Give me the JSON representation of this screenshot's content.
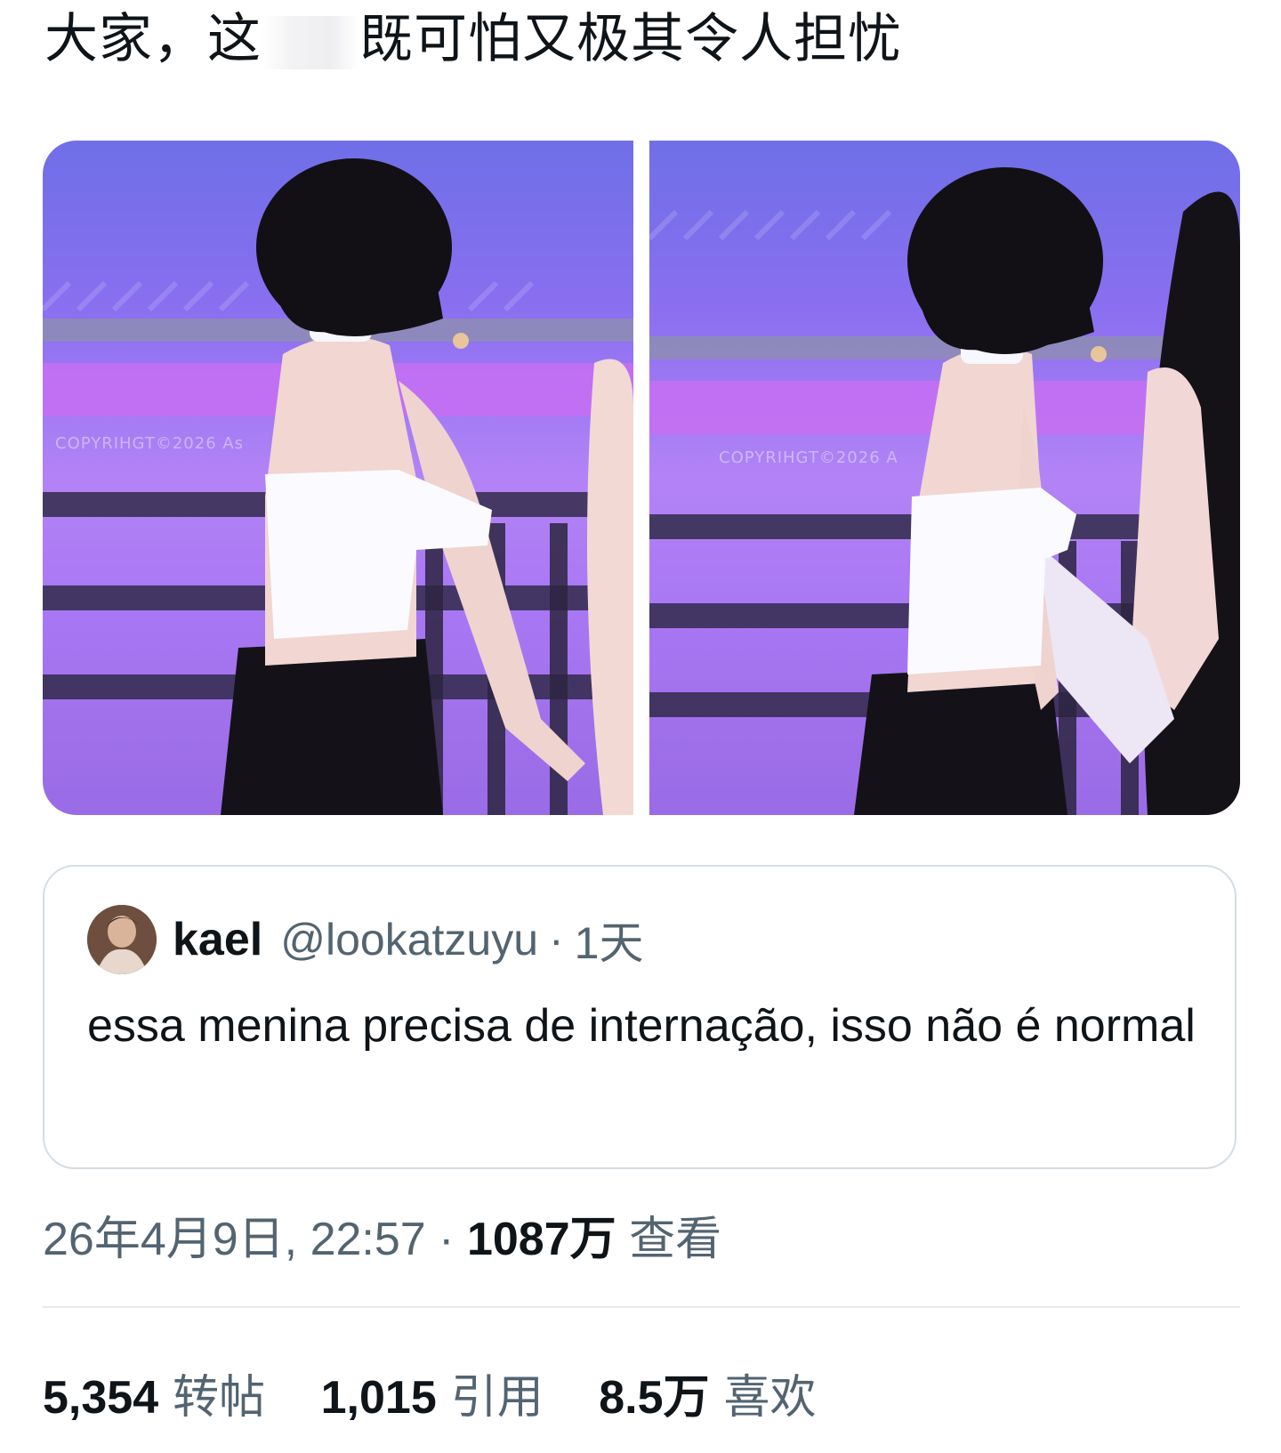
{
  "tweet": {
    "text_before_gap": "大家，这",
    "text_after_gap": "既可怕又极其令人担忧"
  },
  "media": {
    "photos": [
      {
        "watermark": "COPYRIHGT©2026 As"
      },
      {
        "watermark": "COPYRIHGT©2026 A"
      }
    ]
  },
  "quoted_tweet": {
    "name": "kael",
    "handle": "@lookatzuyu",
    "separator": "·",
    "time": "1天",
    "text": "essa menina precisa de internação,  isso não é normal"
  },
  "meta": {
    "timestamp": "26年4月9日, 22:57",
    "separator": "·",
    "views_count": "1087万",
    "views_label": "查看"
  },
  "stats": {
    "reposts_count": "5,354",
    "reposts_label": "转帖",
    "quotes_count": "1,015",
    "quotes_label": "引用",
    "likes_count": "8.5万",
    "likes_label": "喜欢"
  },
  "colors": {
    "text": "#0f1419",
    "secondary": "#536471",
    "border": "#d6dde3",
    "stage_purple": "#a877f3"
  }
}
